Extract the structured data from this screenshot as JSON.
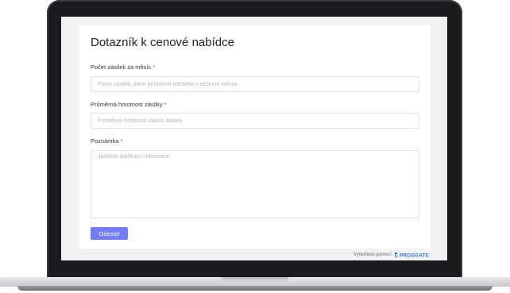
{
  "form": {
    "title": "Dotazník k cenové nabídce",
    "required_mark": "*",
    "fields": [
      {
        "label": "Počet zásilek za měsíc",
        "placeholder": "Počet zásilek, které průměrně odešlete v běžném měsíci"
      },
      {
        "label": "Průměrná hmotnost zásilky",
        "placeholder": "Průměrná hmotnost vašich zásilek"
      },
      {
        "label": "Poznámka",
        "placeholder": "Jakékoli doplňující informace"
      }
    ],
    "submit_label": "Odeslat"
  },
  "footer": {
    "powered_by": "Vytvořeno pomocí",
    "logo_text": "PROSGATE",
    "logo_icon": "prosgate-logo-icon"
  },
  "colors": {
    "accent": "#727cf5",
    "required": "#e03131",
    "brand": "#2f6fe0"
  }
}
